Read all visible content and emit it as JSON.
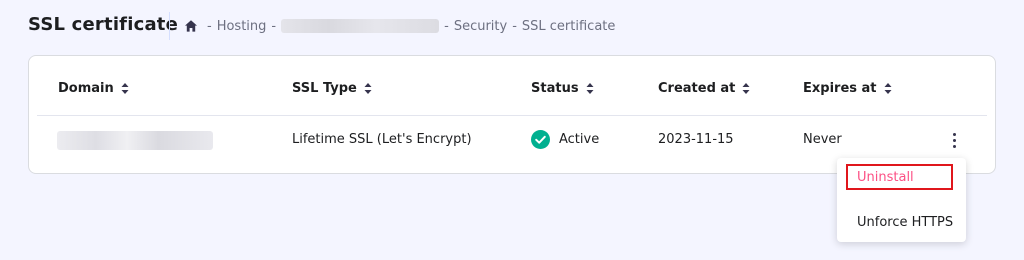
{
  "header": {
    "title": "SSL certificate",
    "breadcrumb": {
      "home_icon": "home-icon",
      "separator": "-",
      "items": [
        "Hosting",
        "Security",
        "SSL certificate"
      ]
    }
  },
  "table": {
    "columns": [
      "Domain",
      "SSL Type",
      "Status",
      "Created at",
      "Expires at"
    ],
    "sort_icon": "sort-icon",
    "rows": [
      {
        "domain": "",
        "ssl_type": "Lifetime SSL (Let's Encrypt)",
        "status": "Active",
        "status_icon": "check-circle-icon",
        "created_at": "2023-11-15",
        "expires_at": "Never"
      }
    ]
  },
  "actions_menu": {
    "trigger_icon": "kebab-menu-icon",
    "items": [
      "Uninstall",
      "Unforce HTTPS"
    ]
  },
  "colors": {
    "background": "#f4f5ff",
    "status_green": "#00b090",
    "danger": "#fc5185",
    "highlight": "#e0161c"
  }
}
